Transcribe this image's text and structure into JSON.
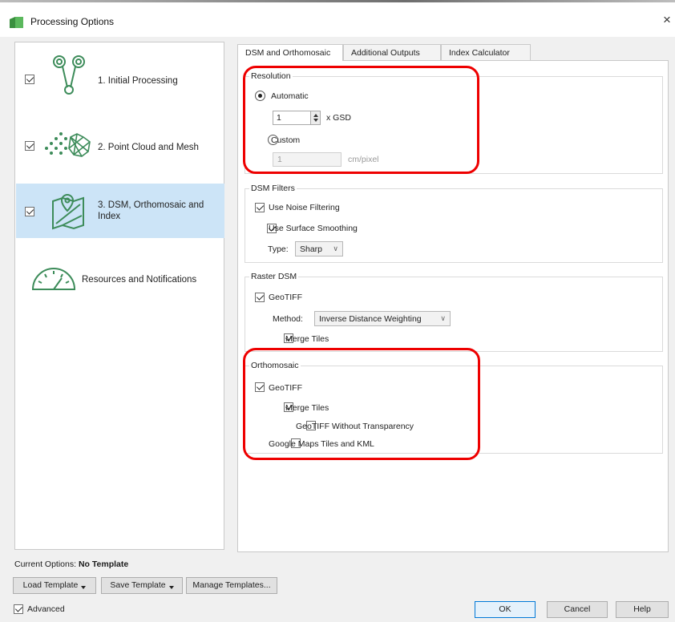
{
  "window": {
    "title": "Processing Options",
    "close_glyph": "×"
  },
  "steps": [
    {
      "label": "1. Initial Processing",
      "checked": true,
      "icon": "initial-processing-icon"
    },
    {
      "label": "2. Point Cloud and Mesh",
      "checked": true,
      "icon": "point-cloud-icon"
    },
    {
      "label_line1": "3. DSM, Orthomosaic and",
      "label_line2": "Index",
      "checked": true,
      "icon": "map-icon",
      "selected": true
    },
    {
      "label": "Resources and Notifications",
      "icon": "gauge-icon"
    }
  ],
  "tabs": [
    "DSM and Orthomosaic",
    "Additional Outputs",
    "Index Calculator"
  ],
  "resolution": {
    "title": "Resolution",
    "automatic_label": "Automatic",
    "gsd_value": "1",
    "gsd_unit": "x GSD",
    "custom_label": "Custom",
    "custom_value": "1",
    "custom_unit": "cm/pixel"
  },
  "dsm_filters": {
    "title": "DSM Filters",
    "noise_label": "Use Noise Filtering",
    "smoothing_label": "Use Surface Smoothing",
    "type_label": "Type:",
    "type_value": "Sharp"
  },
  "raster_dsm": {
    "title": "Raster DSM",
    "geotiff_label": "GeoTIFF",
    "method_label": "Method:",
    "method_value": "Inverse Distance Weighting",
    "merge_label": "Merge Tiles"
  },
  "orthomosaic": {
    "title": "Orthomosaic",
    "geotiff_label": "GeoTIFF",
    "merge_label": "Merge Tiles",
    "no_transparency_label": "GeoTIFF Without Transparency",
    "google_label": "Google Maps Tiles and KML"
  },
  "footer": {
    "current_options_label": "Current Options:",
    "current_options_value": "No Template",
    "load_template": "Load Template",
    "save_template": "Save Template",
    "manage_templates": "Manage Templates...",
    "advanced_label": "Advanced",
    "ok": "OK",
    "cancel": "Cancel",
    "help": "Help"
  },
  "colors": {
    "accent_red": "#ee0000",
    "selection_blue": "#cce4f7",
    "icon_green": "#3d8c5a"
  }
}
